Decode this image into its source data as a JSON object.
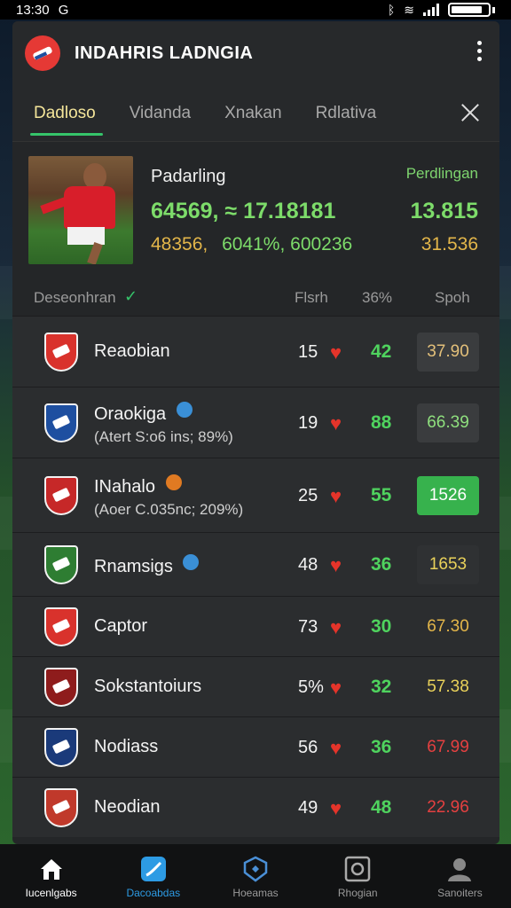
{
  "status_bar": {
    "time": "13:30",
    "carrier_glyph": "G"
  },
  "header": {
    "title": "INDAHRIS LADNGIA"
  },
  "tabs": [
    {
      "label": "Dadloso",
      "active": true
    },
    {
      "label": "Vidanda",
      "active": false
    },
    {
      "label": "Xnakan",
      "active": false
    },
    {
      "label": "Rdlativa",
      "active": false
    }
  ],
  "feature": {
    "name": "Padarling",
    "label": "Perdlingan",
    "line1": "64569, ≈ 17.18181",
    "value1": "13.815",
    "line2_a": "48356,",
    "line2_b": "6041%, 600236",
    "value2": "31.536"
  },
  "columns": {
    "name": "Deseonhran",
    "col_a": "Flsrh",
    "col_b": "36%",
    "col_c": "Spoh"
  },
  "teams": [
    {
      "name": "Reaobian",
      "sub": "",
      "badge_color": "",
      "num_a": "15",
      "num_b": "42",
      "score": "37.90",
      "score_color": "#e3c07a",
      "score_bg": "#3a3c3e",
      "crest_color": "#d9322c"
    },
    {
      "name": "Oraokiga",
      "sub": "(Atert S:o6 ins; 89%)",
      "badge_color": "#3a8fd6",
      "num_a": "19",
      "num_b": "88",
      "score": "66.39",
      "score_color": "#8fe07e",
      "score_bg": "#3a3c3e",
      "crest_color": "#1e4fa0"
    },
    {
      "name": "INahalo",
      "sub": "(Aoer C.035nc; 209%)",
      "badge_color": "#e07a22",
      "num_a": "25",
      "num_b": "55",
      "score": "1526",
      "score_color": "#ffffff",
      "score_bg": "#37b24d",
      "crest_color": "#c62828"
    },
    {
      "name": "Rnamsigs",
      "sub": "",
      "badge_color": "#3a8fd6",
      "num_a": "48",
      "num_b": "36",
      "score": "1653",
      "score_color": "#e9d15a",
      "score_bg": "#2f3133",
      "crest_color": "#2e7d32"
    },
    {
      "name": "Captor",
      "sub": "",
      "badge_color": "",
      "num_a": "73",
      "num_b": "30",
      "score": "67.30",
      "score_color": "#e3b64a",
      "score_bg": "transparent",
      "crest_color": "#d9322c"
    },
    {
      "name": "Sokstantoiurs",
      "sub": "",
      "badge_color": "",
      "num_a": "5%",
      "num_b": "32",
      "score": "57.38",
      "score_color": "#e9d15a",
      "score_bg": "transparent",
      "crest_color": "#8e1c1c"
    },
    {
      "name": "Nodiass",
      "sub": "",
      "badge_color": "",
      "num_a": "56",
      "num_b": "36",
      "score": "67.99",
      "score_color": "#e54040",
      "score_bg": "transparent",
      "crest_color": "#1a3a7a"
    },
    {
      "name": "Neodian",
      "sub": "",
      "badge_color": "",
      "num_a": "49",
      "num_b": "48",
      "score": "22.96",
      "score_color": "#e54040",
      "score_bg": "transparent",
      "crest_color": "#c0392b"
    }
  ],
  "bottom_nav": [
    {
      "label": "Iucenlgabs",
      "icon": "home-icon"
    },
    {
      "label": "Dacoabdas",
      "icon": "stats-icon"
    },
    {
      "label": "Hoeamas",
      "icon": "shield-icon"
    },
    {
      "label": "Rhogian",
      "icon": "square-icon"
    },
    {
      "label": "Sanoiters",
      "icon": "profile-icon"
    }
  ]
}
